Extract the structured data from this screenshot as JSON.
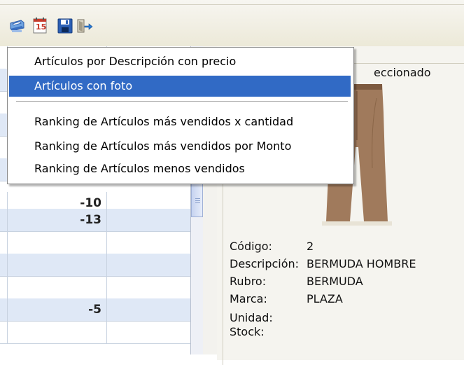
{
  "toolbar": {
    "buttons": [
      {
        "name": "print",
        "icon": "printer-icon"
      },
      {
        "name": "calendar",
        "icon": "calendar-icon",
        "label": "15"
      },
      {
        "name": "save",
        "icon": "floppy-disk-icon"
      },
      {
        "name": "exit",
        "icon": "exit-door-icon"
      }
    ]
  },
  "menu": {
    "items": [
      {
        "label": "Artículos por Descripción con precio",
        "selected": false
      },
      {
        "label": "Artículos con foto",
        "selected": true
      },
      {
        "label": "Ranking de Artículos más vendidos x cantidad",
        "selected": false
      },
      {
        "label": "Ranking de Artículos más vendidos por Monto",
        "selected": false
      },
      {
        "label": "Ranking de Artículos menos vendidos",
        "selected": false
      }
    ]
  },
  "grid": {
    "rows": [
      {
        "qty": ""
      },
      {
        "qty": ""
      },
      {
        "qty": ""
      },
      {
        "qty": ""
      },
      {
        "qty": ""
      },
      {
        "qty": ""
      },
      {
        "qty": "-10"
      },
      {
        "qty": "-13"
      },
      {
        "qty": ""
      },
      {
        "qty": ""
      },
      {
        "qty": ""
      },
      {
        "qty": "-5"
      },
      {
        "qty": ""
      }
    ]
  },
  "panel": {
    "title": "eccionado",
    "fields": [
      {
        "label": "Código:",
        "value": "2"
      },
      {
        "label": "Descripción:",
        "value": "BERMUDA HOMBRE"
      },
      {
        "label": "Rubro:",
        "value": "BERMUDA"
      },
      {
        "label": "Marca:",
        "value": "PLAZA"
      },
      {
        "label": "Unidad:",
        "value": ""
      },
      {
        "label": "Stock:",
        "value": ""
      }
    ]
  },
  "colors": {
    "selection": "#316ac5",
    "grid_shade": "#dfe8f6",
    "panel_bg": "#f5f4ef"
  }
}
